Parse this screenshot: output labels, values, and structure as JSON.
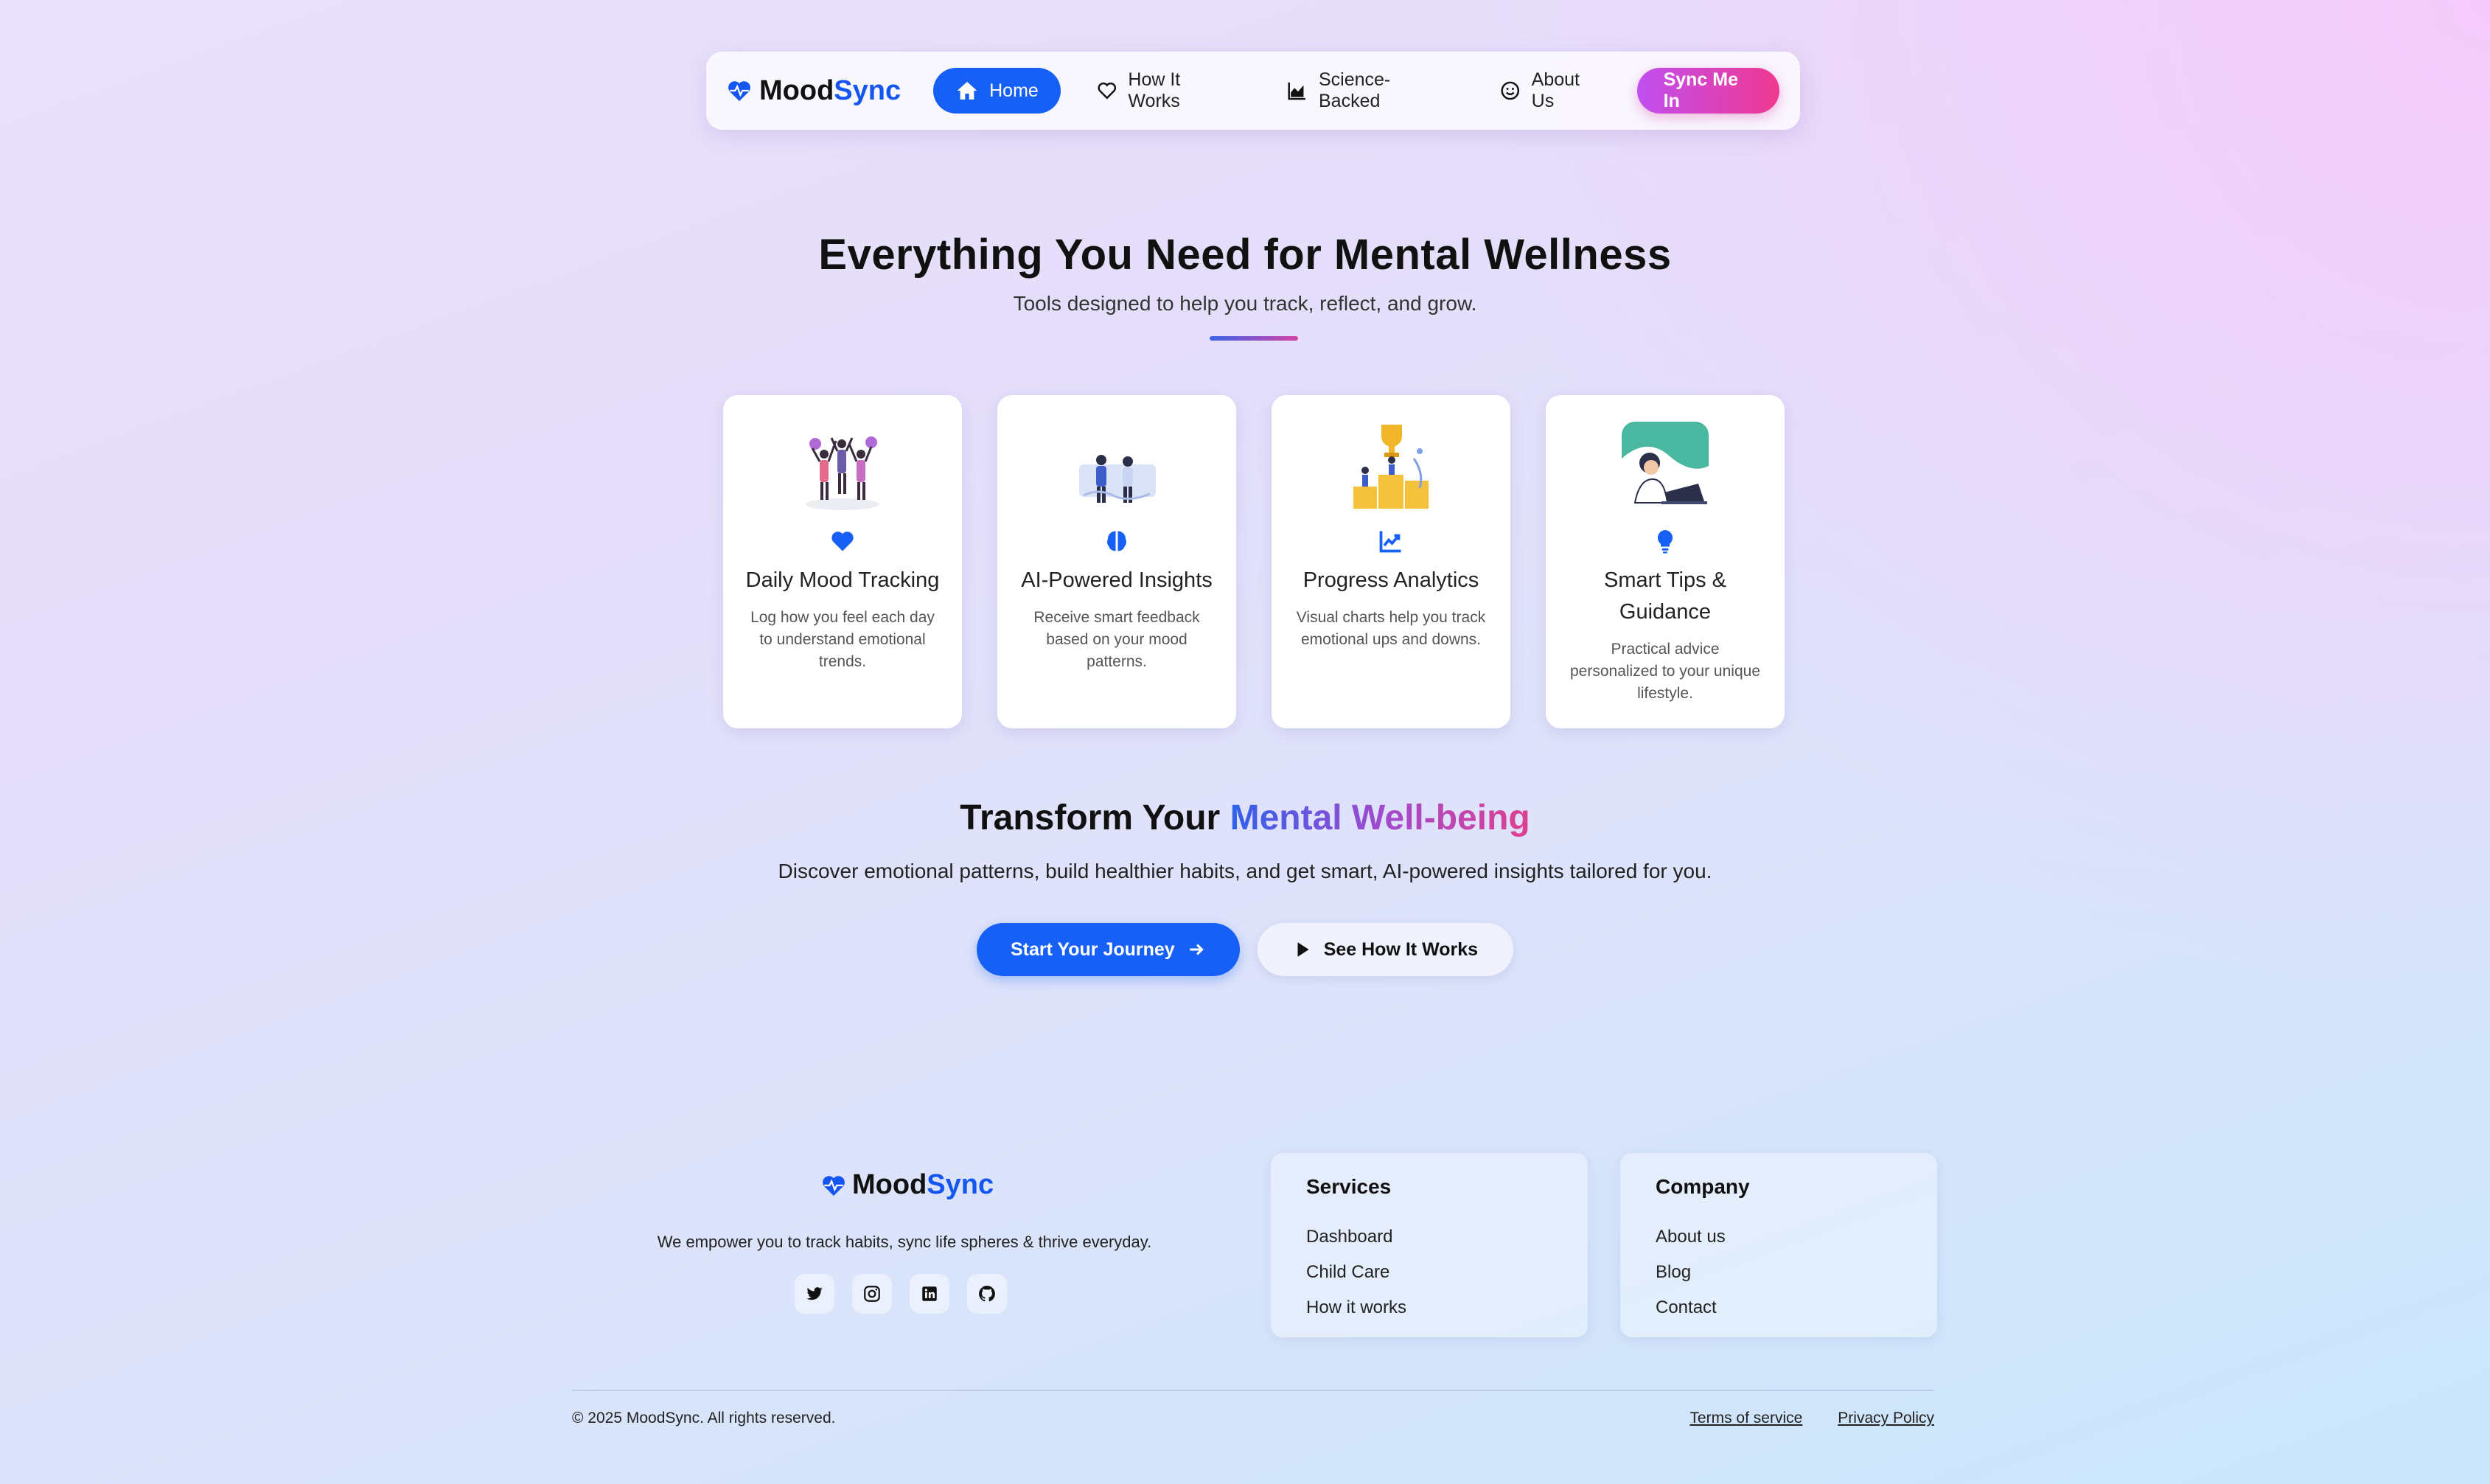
{
  "nav": {
    "brand_part1": "Mood",
    "brand_part2": "Sync",
    "items": [
      {
        "label": "Home",
        "icon": "home-icon",
        "active": true
      },
      {
        "label": "How It Works",
        "icon": "heart-outline-icon"
      },
      {
        "label": "Science-Backed",
        "icon": "area-chart-icon"
      },
      {
        "label": "About Us",
        "icon": "smile-icon"
      }
    ],
    "cta_label": "Sync Me In"
  },
  "features": {
    "title": "Everything You Need for Mental Wellness",
    "subtitle": "Tools designed to help you track, reflect, and grow.",
    "cards": [
      {
        "title": "Daily Mood Tracking",
        "desc": "Log how you feel each day to understand emotional trends.",
        "icon": "heart-icon"
      },
      {
        "title": "AI-Powered Insights",
        "desc": "Receive smart feedback based on your mood patterns.",
        "icon": "brain-icon"
      },
      {
        "title": "Progress Analytics",
        "desc": "Visual charts help you track emotional ups and downs.",
        "icon": "trend-chart-icon"
      },
      {
        "title": "Smart Tips & Guidance",
        "desc": "Practical advice personalized to your unique lifestyle.",
        "icon": "lightbulb-icon"
      }
    ]
  },
  "transform": {
    "title_plain": "Transform Your ",
    "title_highlight": "Mental Well-being",
    "subtitle": "Discover emotional patterns, build healthier habits, and get smart, AI-powered insights tailored for you.",
    "primary_button": "Start Your Journey",
    "secondary_button": "See How It Works"
  },
  "footer": {
    "brand_part1": "Mood",
    "brand_part2": "Sync",
    "tagline": "We empower you to track habits, sync life spheres & thrive everyday.",
    "socials": [
      "twitter-icon",
      "instagram-icon",
      "linkedin-icon",
      "github-icon"
    ],
    "services": {
      "heading": "Services",
      "links": [
        "Dashboard",
        "Child Care",
        "How it works"
      ]
    },
    "company": {
      "heading": "Company",
      "links": [
        "About us",
        "Blog",
        "Contact"
      ]
    },
    "copyright": "© 2025 MoodSync. All rights reserved.",
    "terms": "Terms of service",
    "privacy": "Privacy Policy"
  },
  "colors": {
    "accent_blue": "#1660f5",
    "cta_gradient_start": "#c04ff0",
    "cta_gradient_end": "#f0398f"
  }
}
